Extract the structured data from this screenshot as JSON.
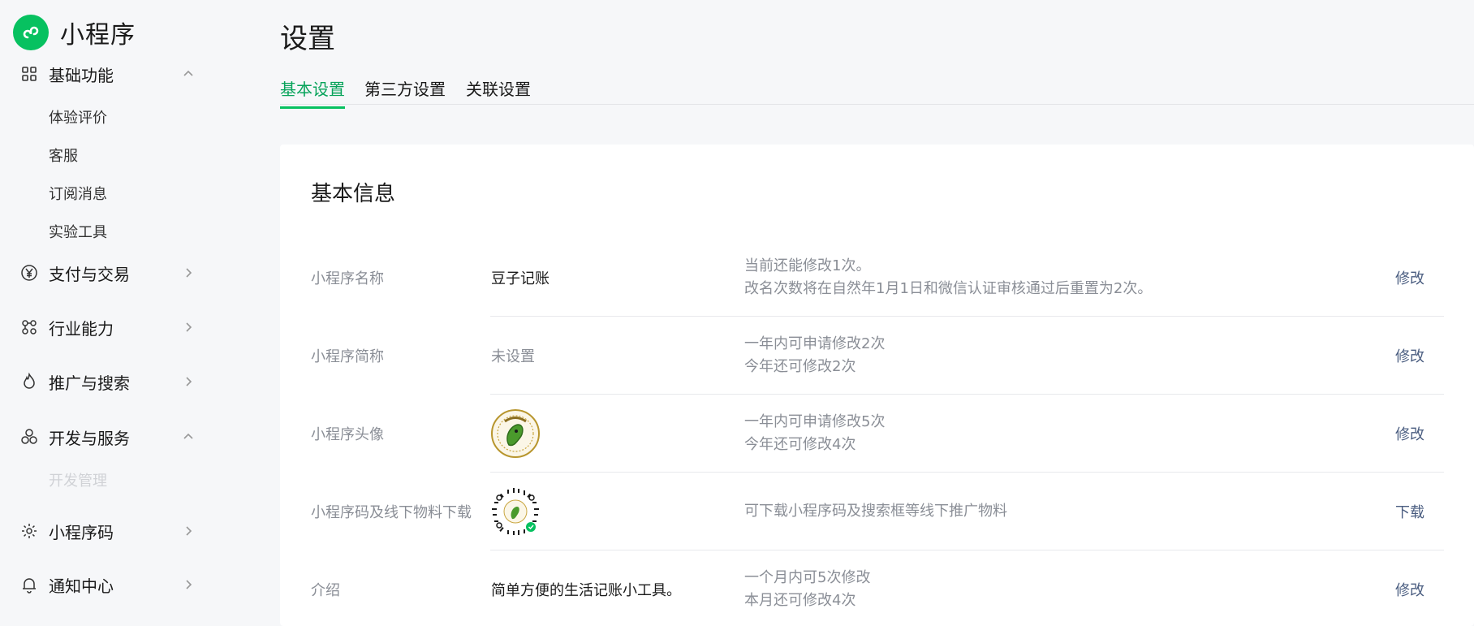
{
  "brand": {
    "name": "小程序",
    "logo_icon": "miniprogram-logo-icon",
    "color": "#07c160"
  },
  "sidebar": {
    "groups": [
      {
        "label": "基础功能",
        "icon": "grid-icon",
        "expanded": true,
        "items": [
          "体验评价",
          "客服",
          "订阅消息",
          "实验工具"
        ]
      },
      {
        "label": "支付与交易",
        "icon": "yen-icon",
        "expanded": false
      },
      {
        "label": "行业能力",
        "icon": "nodes-icon",
        "expanded": false
      },
      {
        "label": "推广与搜索",
        "icon": "flame-icon",
        "expanded": false
      },
      {
        "label": "开发与服务",
        "icon": "circles-icon",
        "expanded": true,
        "items": [
          "开发管理"
        ]
      },
      {
        "label": "小程序码",
        "icon": "qrcode-spark-icon",
        "expanded": false
      },
      {
        "label": "通知中心",
        "icon": "bell-icon",
        "expanded": false
      }
    ]
  },
  "header": {
    "title": "设置"
  },
  "tabs": [
    {
      "label": "基本设置",
      "active": true
    },
    {
      "label": "第三方设置",
      "active": false
    },
    {
      "label": "关联设置",
      "active": false
    }
  ],
  "card": {
    "title": "基本信息",
    "rows": [
      {
        "label": "小程序名称",
        "value": "豆子记账",
        "desc": [
          "当前还能修改1次。",
          "改名次数将在自然年1月1日和微信认证审核通过后重置为2次。"
        ],
        "action": "修改"
      },
      {
        "label": "小程序简称",
        "value": "未设置",
        "desc": [
          "一年内可申请修改2次",
          "今年还可修改2次"
        ],
        "action": "修改"
      },
      {
        "label": "小程序头像",
        "desc": [
          "一年内可申请修改5次",
          "今年还可修改4次"
        ],
        "action": "修改"
      },
      {
        "label": "小程序码及线下物料下载",
        "desc": [
          "可下载小程序码及搜索框等线下推广物料"
        ],
        "action": "下载"
      },
      {
        "label": "介绍",
        "value": "简单方便的生活记账小工具。",
        "desc": [
          "一个月内可5次修改",
          "本月还可修改4次"
        ],
        "action": "修改"
      }
    ]
  },
  "colors": {
    "accent": "#07c160",
    "link": "#4a5d80",
    "muted": "#8a8e96"
  }
}
